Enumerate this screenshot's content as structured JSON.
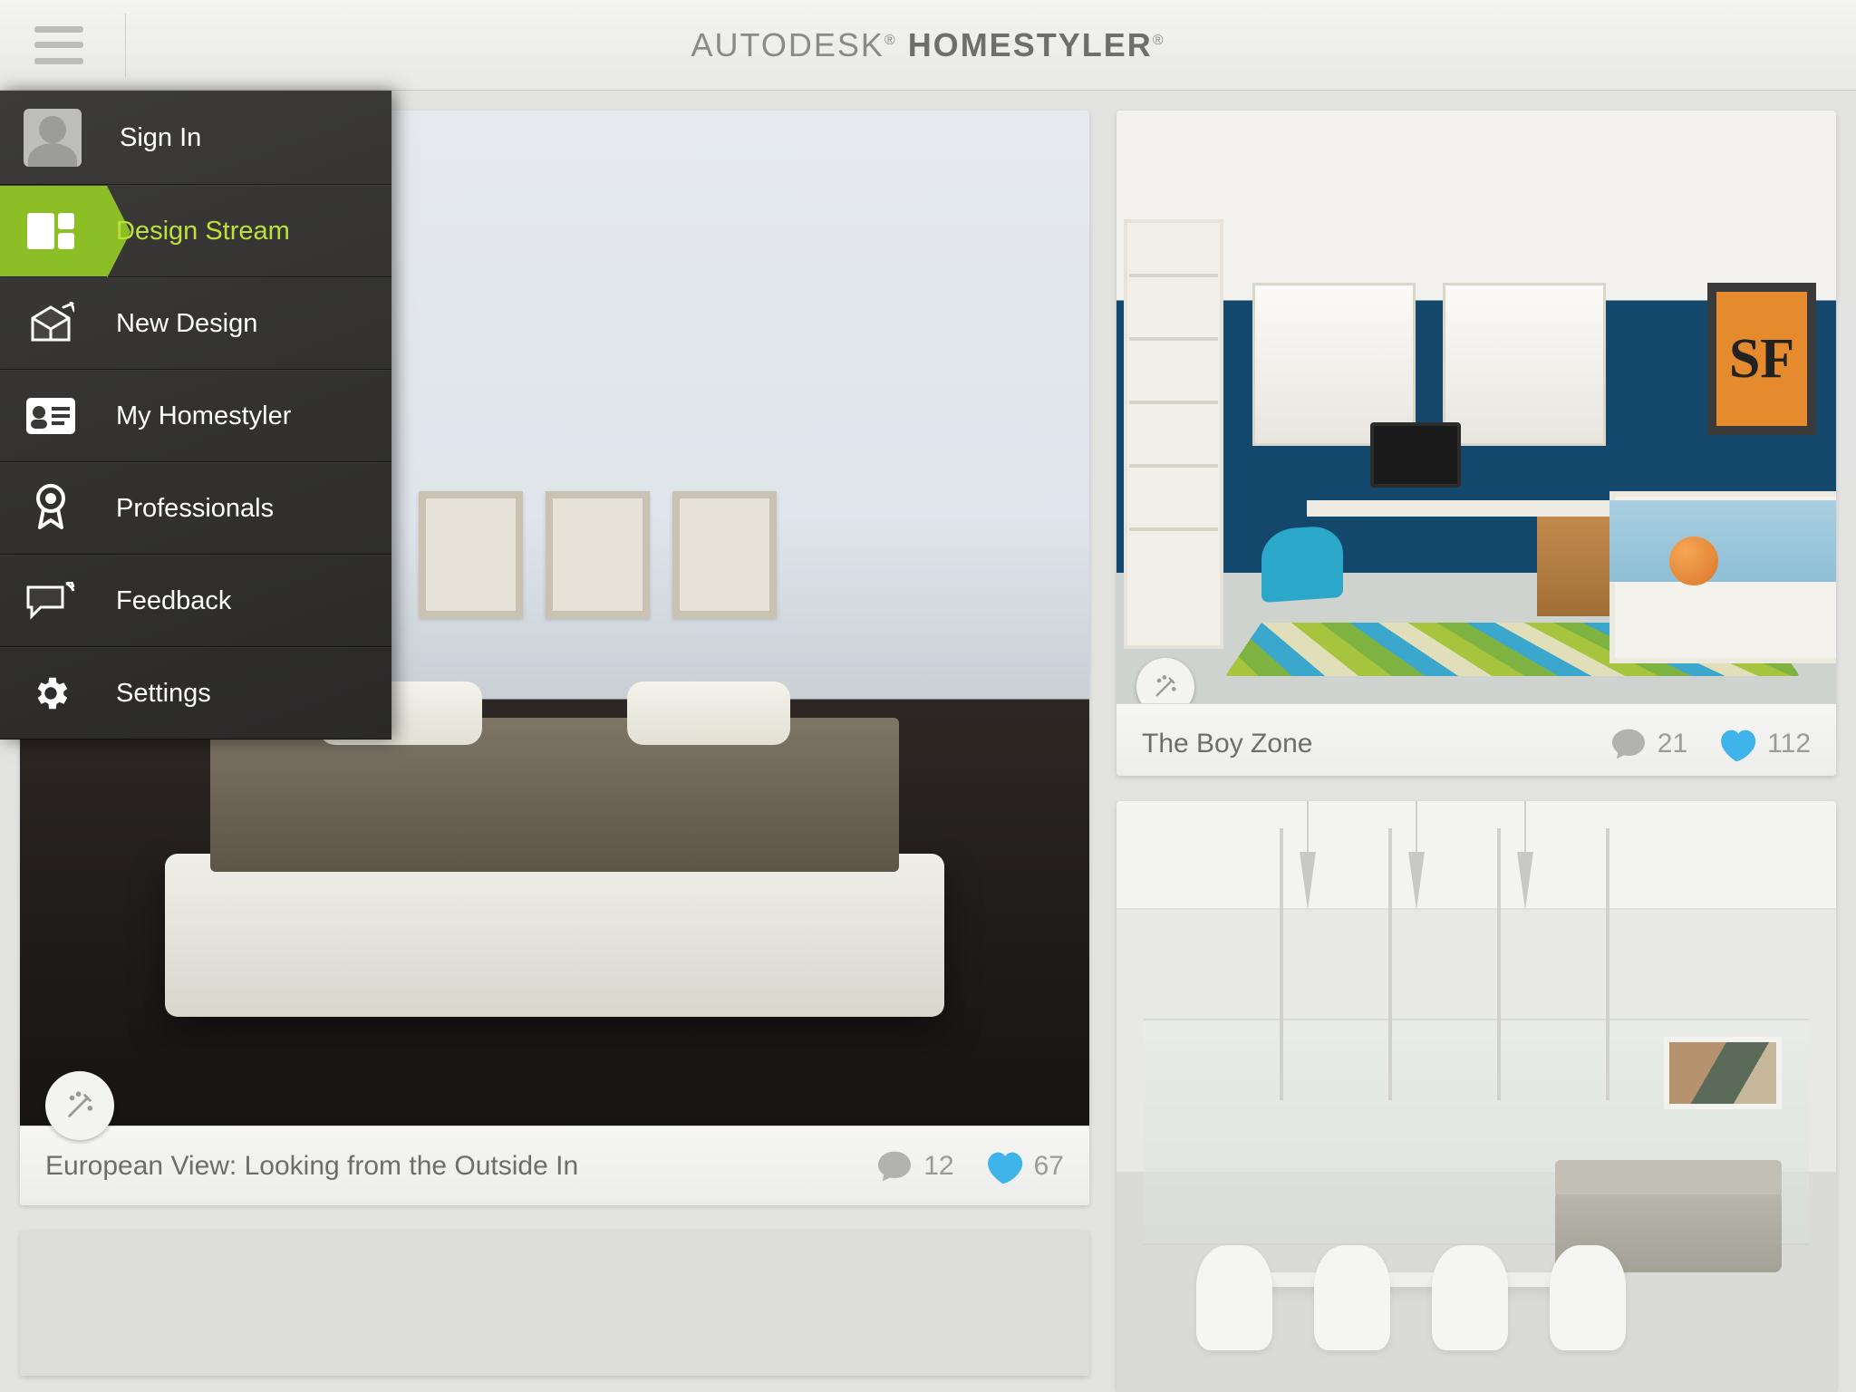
{
  "brand": {
    "prefix": "AUTODESK",
    "name": "HOMESTYLER"
  },
  "sidebar": {
    "signin_label": "Sign In",
    "items": [
      {
        "label": "Design Stream"
      },
      {
        "label": "New Design"
      },
      {
        "label": "My Homestyler"
      },
      {
        "label": "Professionals"
      },
      {
        "label": "Feedback"
      },
      {
        "label": "Settings"
      }
    ]
  },
  "cards": {
    "european": {
      "title": "European View: Looking from the Outside In",
      "comments": "12",
      "likes": "67"
    },
    "boyzone": {
      "title": "The Boy Zone",
      "comments": "21",
      "likes": "112",
      "poster_text": "SF"
    }
  },
  "colors": {
    "accent_green": "#8cbf26",
    "accent_green_text": "#bfe03c",
    "like_blue": "#3fb4ea",
    "comment_grey": "#b2b2b0"
  }
}
